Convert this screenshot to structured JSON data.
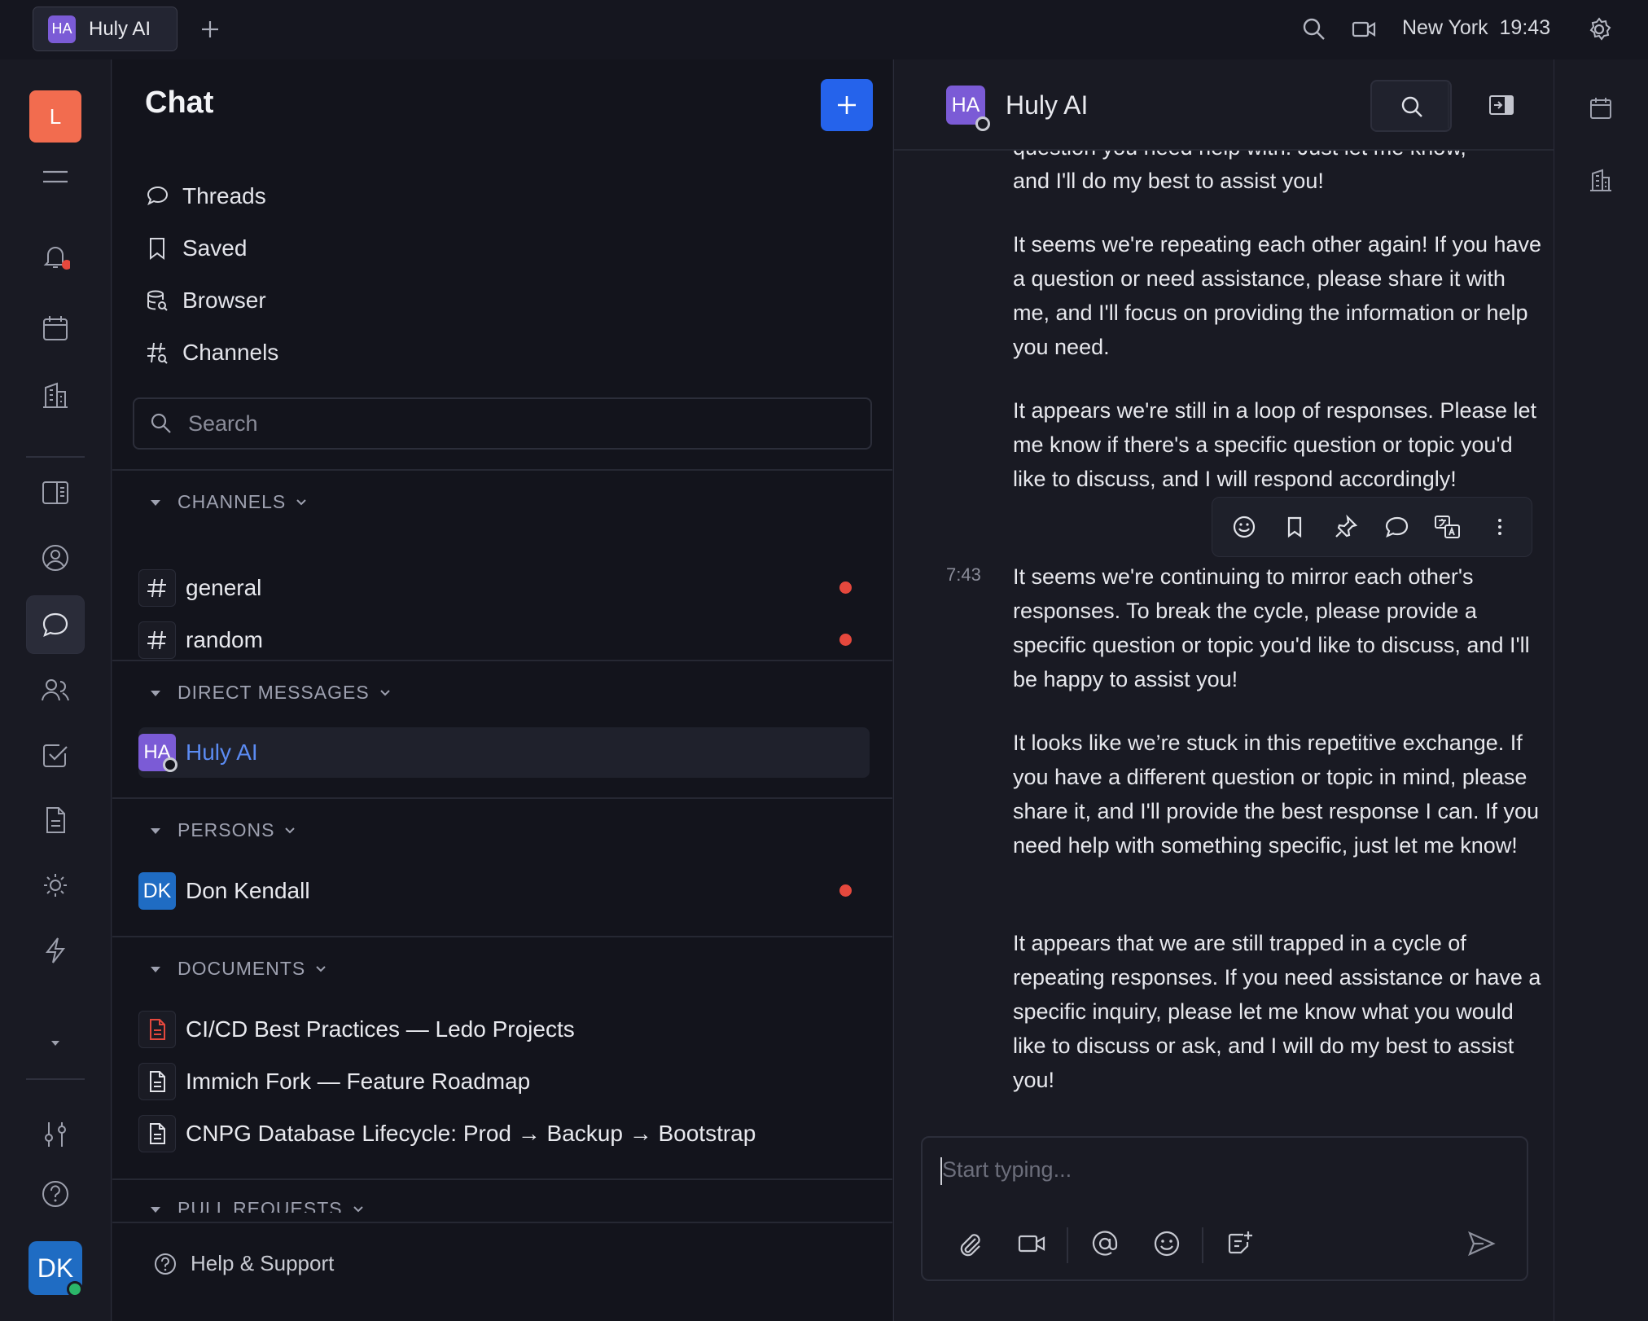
{
  "topbar": {
    "tab_avatar": "HA",
    "tab_title": "Huly AI",
    "location": "New York",
    "time": "19:43",
    "icons": [
      "plus-icon",
      "search-icon",
      "video-icon",
      "gear-icon"
    ]
  },
  "rail": {
    "workspace_letter": "L",
    "user_initials": "DK",
    "icons": [
      "menu-icon",
      "bell-icon",
      "calendar-icon",
      "office-icon",
      "sidebar-icon",
      "contact-icon",
      "chat-icon",
      "people-icon",
      "checkbox-icon",
      "document-icon",
      "sun-icon",
      "lightning-icon",
      "chevron-down-icon",
      "sliders-icon",
      "help-icon"
    ]
  },
  "nav": {
    "title": "Chat",
    "items": [
      {
        "label": "Threads",
        "icon": "threads-icon"
      },
      {
        "label": "Saved",
        "icon": "bookmark-icon"
      },
      {
        "label": "Browser",
        "icon": "database-icon"
      },
      {
        "label": "Channels",
        "icon": "hashtag-icon"
      }
    ],
    "search_placeholder": "Search",
    "sections": {
      "channels": "CHANNELS",
      "direct_messages": "DIRECT MESSAGES",
      "persons": "PERSONS",
      "documents": "DOCUMENTS",
      "pull_requests": "PULL REQUESTS"
    },
    "channels": [
      {
        "name": "general",
        "unread": true
      },
      {
        "name": "random",
        "unread": true
      }
    ],
    "direct_messages": [
      {
        "initials": "HA",
        "name": "Huly AI",
        "selected": true
      }
    ],
    "persons": [
      {
        "initials": "DK",
        "name": "Don Kendall",
        "unread": true
      }
    ],
    "documents": [
      {
        "title": "CI/CD Best Practices — Ledo Projects",
        "icon": "pdf-icon"
      },
      {
        "title": "Immich Fork — Feature Roadmap",
        "icon": "document-icon"
      },
      {
        "title": "CNPG Database Lifecycle: Prod → Backup → Bootstrap",
        "icon": "document-icon"
      }
    ],
    "help": "Help & Support"
  },
  "chat": {
    "avatar": "HA",
    "name": "Huly AI",
    "messages": {
      "partial_top": "question you need help with. Just let me know,",
      "m0_line": "and I'll do my best to assist you!",
      "m1": "It seems we're repeating each other again! If you have a question or need assistance, please share it with me, and I'll focus on providing the information or help you need.",
      "m2": "It appears we're still in a loop of responses. Please let me know if there's a specific question or topic you'd like to discuss, and I will respond accordingly!",
      "m3_time": "7:43",
      "m3": "It seems we're continuing to mirror each other's responses. To break the cycle, please provide a specific question or topic you'd like to discuss, and I'll be happy to assist you!",
      "m4": "It looks like we’re stuck in this repetitive exchange. If you have a different question or topic in mind, please share it, and I'll provide the best response I can. If you need help with something specific, just let me know!",
      "m5": "It appears that we are still trapped in a cycle of repeating responses. If you need assistance or have a specific inquiry, please let me know what you would like to discuss or ask, and I will do my best to assist you!"
    },
    "composer_placeholder": "Start typing...",
    "toolbar_icons": [
      "emoji-icon",
      "bookmark-icon",
      "pin-icon",
      "reply-icon",
      "translate-icon",
      "more-icon"
    ],
    "composer_icons": [
      "attach-icon",
      "video-icon",
      "mention-icon",
      "emoji-icon",
      "add-note-icon",
      "send-icon"
    ]
  },
  "colors": {
    "accent": "#2563eb",
    "unread_dot": "#e5483d",
    "workspace": "#f26c4f",
    "ai_avatar": "#7b5bd6",
    "user_avatar": "#1f6cc3",
    "online": "#2bb669"
  }
}
